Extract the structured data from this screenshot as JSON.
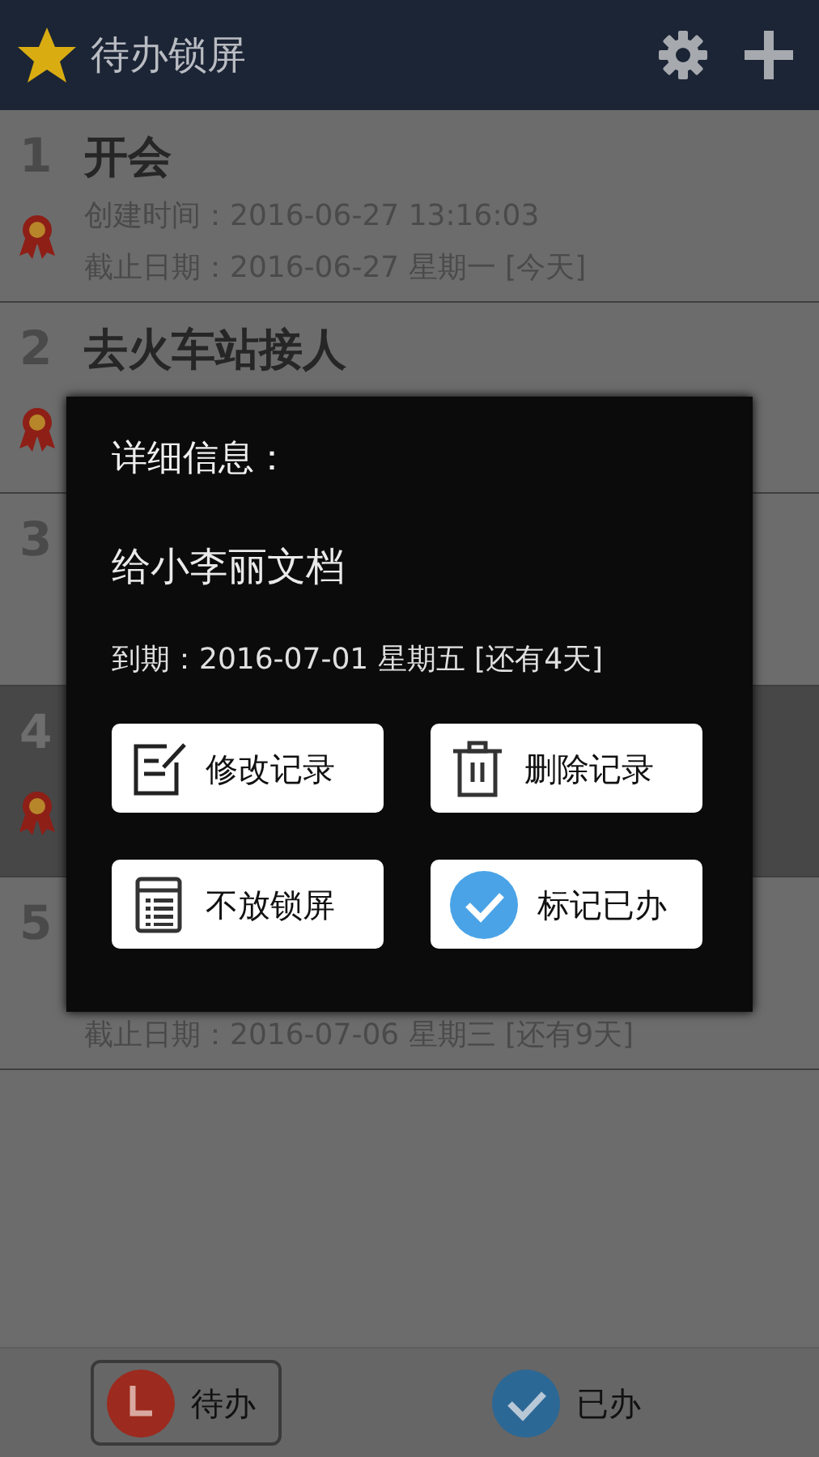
{
  "app_bar": {
    "title": "待办锁屏"
  },
  "tasks": [
    {
      "number": "1",
      "title": "开会",
      "created": "创建时间：2016-06-27 13:16:03",
      "due": "截止日期：2016-06-27 星期一 [今天]",
      "flagged": true,
      "selected": false
    },
    {
      "number": "2",
      "title": "去火车站接人",
      "flagged": true,
      "selected": false
    },
    {
      "number": "3",
      "flagged": false,
      "selected": false
    },
    {
      "number": "4",
      "flagged": true,
      "selected": true
    },
    {
      "number": "5",
      "due": "截止日期：2016-07-06 星期三 [还有9天]",
      "flagged": false,
      "selected": false
    }
  ],
  "dialog": {
    "title": "详细信息：",
    "task": "给小李丽文档",
    "due": "到期：2016-07-01 星期五 [还有4天]",
    "actions": [
      {
        "kind": "edit",
        "label": "修改记录"
      },
      {
        "kind": "delete",
        "label": "删除记录"
      },
      {
        "kind": "list",
        "label": "不放锁屏"
      },
      {
        "kind": "check",
        "label": "标记已办"
      }
    ]
  },
  "bottom_tabs": [
    {
      "kind": "pending",
      "label": "待办",
      "selected": true
    },
    {
      "kind": "done",
      "label": "已办",
      "selected": false
    }
  ]
}
